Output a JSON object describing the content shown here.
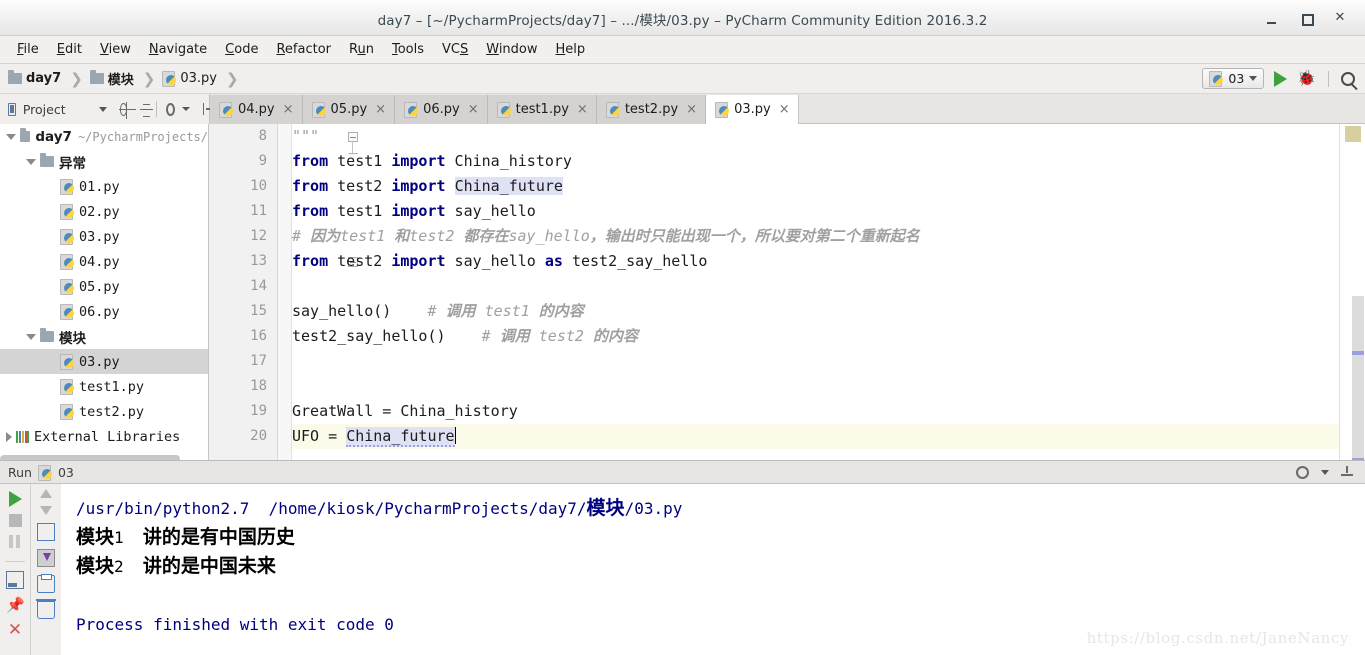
{
  "window": {
    "title": "day7 – [~/PycharmProjects/day7] – .../模块/03.py – PyCharm Community Edition 2016.3.2",
    "minimize_label": "–",
    "maximize_label": "□",
    "close_label": "✕"
  },
  "menubar": {
    "items": [
      {
        "label": "File"
      },
      {
        "label": "Edit"
      },
      {
        "label": "View"
      },
      {
        "label": "Navigate"
      },
      {
        "label": "Code"
      },
      {
        "label": "Refactor"
      },
      {
        "label": "Run"
      },
      {
        "label": "Tools"
      },
      {
        "label": "VCS"
      },
      {
        "label": "Window"
      },
      {
        "label": "Help"
      }
    ]
  },
  "breadcrumb": {
    "separator": "❯",
    "items": [
      {
        "label": "day7",
        "icon": "folder-icon"
      },
      {
        "label": "模块",
        "icon": "folder-icon"
      },
      {
        "label": "03.py",
        "icon": "python-file-icon"
      }
    ],
    "run_config": "03",
    "run_button": "run-icon",
    "debug_button": "debug-bug-icon",
    "search_button": "search-icon"
  },
  "project_panel": {
    "title": "Project",
    "toolbar": [
      "collapse-dropdown-icon",
      "locate-target-icon",
      "collapse-all-icon",
      "gear-icon",
      "hide-icon"
    ],
    "tree": [
      {
        "indent": 0,
        "twisty": "down",
        "icon": "folder-icon",
        "label": "day7",
        "suffix": "~/PycharmProjects/",
        "bold": true,
        "selected": false
      },
      {
        "indent": 1,
        "twisty": "down",
        "icon": "folder-icon",
        "label": "异常",
        "suffix": "",
        "bold": true,
        "selected": false
      },
      {
        "indent": 2,
        "twisty": "none",
        "icon": "python-file-icon",
        "label": "01.py",
        "suffix": "",
        "bold": false,
        "selected": false
      },
      {
        "indent": 2,
        "twisty": "none",
        "icon": "python-file-icon",
        "label": "02.py",
        "suffix": "",
        "bold": false,
        "selected": false
      },
      {
        "indent": 2,
        "twisty": "none",
        "icon": "python-file-icon",
        "label": "03.py",
        "suffix": "",
        "bold": false,
        "selected": false
      },
      {
        "indent": 2,
        "twisty": "none",
        "icon": "python-file-icon",
        "label": "04.py",
        "suffix": "",
        "bold": false,
        "selected": false
      },
      {
        "indent": 2,
        "twisty": "none",
        "icon": "python-file-icon",
        "label": "05.py",
        "suffix": "",
        "bold": false,
        "selected": false
      },
      {
        "indent": 2,
        "twisty": "none",
        "icon": "python-file-icon",
        "label": "06.py",
        "suffix": "",
        "bold": false,
        "selected": false
      },
      {
        "indent": 1,
        "twisty": "down",
        "icon": "folder-icon",
        "label": "模块",
        "suffix": "",
        "bold": true,
        "selected": false
      },
      {
        "indent": 2,
        "twisty": "none",
        "icon": "python-file-icon",
        "label": "03.py",
        "suffix": "",
        "bold": false,
        "selected": true
      },
      {
        "indent": 2,
        "twisty": "none",
        "icon": "python-file-icon",
        "label": "test1.py",
        "suffix": "",
        "bold": false,
        "selected": false
      },
      {
        "indent": 2,
        "twisty": "none",
        "icon": "python-file-icon",
        "label": "test2.py",
        "suffix": "",
        "bold": false,
        "selected": false
      },
      {
        "indent": 0,
        "twisty": "right",
        "icon": "library-icon",
        "label": "External Libraries",
        "suffix": "",
        "bold": false,
        "selected": false
      }
    ]
  },
  "editor_tabs": [
    {
      "label": "04.py",
      "active": false,
      "close": "×"
    },
    {
      "label": "05.py",
      "active": false,
      "close": "×"
    },
    {
      "label": "06.py",
      "active": false,
      "close": "×"
    },
    {
      "label": "test1.py",
      "active": false,
      "close": "×"
    },
    {
      "label": "test2.py",
      "active": false,
      "close": "×"
    },
    {
      "label": "03.py",
      "active": true,
      "close": "×"
    }
  ],
  "editor": {
    "first_line_number": 8,
    "current_line": 20,
    "lines": [
      {
        "n": 8,
        "segments": [
          {
            "t": "\"\"\"",
            "c": "cmt"
          }
        ]
      },
      {
        "n": 9,
        "segments": [
          {
            "t": "from",
            "c": "kw"
          },
          {
            "t": " test1 ",
            "c": ""
          },
          {
            "t": "import",
            "c": "kw"
          },
          {
            "t": " China_history",
            "c": ""
          }
        ]
      },
      {
        "n": 10,
        "segments": [
          {
            "t": "from",
            "c": "kw"
          },
          {
            "t": " test2 ",
            "c": ""
          },
          {
            "t": "import",
            "c": "kw"
          },
          {
            "t": " ",
            "c": ""
          },
          {
            "t": "China_future",
            "c": "hl"
          }
        ]
      },
      {
        "n": 11,
        "segments": [
          {
            "t": "from",
            "c": "kw"
          },
          {
            "t": " test1 ",
            "c": ""
          },
          {
            "t": "import",
            "c": "kw"
          },
          {
            "t": " say_hello",
            "c": ""
          }
        ]
      },
      {
        "n": 12,
        "segments": [
          {
            "t": "# 因为test1 和test2 都存在say_hello，输出时只能出现一个，所以要对第二个重新起名",
            "c": "cmt"
          }
        ]
      },
      {
        "n": 13,
        "segments": [
          {
            "t": "from",
            "c": "kw"
          },
          {
            "t": " test2 ",
            "c": ""
          },
          {
            "t": "import",
            "c": "kw"
          },
          {
            "t": " say_hello ",
            "c": ""
          },
          {
            "t": "as",
            "c": "kw"
          },
          {
            "t": " test2_say_hello",
            "c": ""
          }
        ]
      },
      {
        "n": 14,
        "segments": []
      },
      {
        "n": 15,
        "segments": [
          {
            "t": "say_hello()    ",
            "c": ""
          },
          {
            "t": "# 调用 test1 的内容",
            "c": "cmt"
          }
        ]
      },
      {
        "n": 16,
        "segments": [
          {
            "t": "test2_say_hello()    ",
            "c": ""
          },
          {
            "t": "# 调用 test2 的内容",
            "c": "cmt"
          }
        ]
      },
      {
        "n": 17,
        "segments": []
      },
      {
        "n": 18,
        "segments": []
      },
      {
        "n": 19,
        "segments": [
          {
            "t": "GreatWall = China_history",
            "c": ""
          }
        ]
      },
      {
        "n": 20,
        "segments": [
          {
            "t": "UFO = ",
            "c": ""
          },
          {
            "t": "China_future",
            "c": "err"
          }
        ]
      }
    ]
  },
  "run_panel": {
    "title": "Run",
    "config_name": "03",
    "icon": "python-icon",
    "left_toolbar": [
      "rerun-icon",
      "stop-icon",
      "pause-icon",
      "show-variables-icon",
      "pin-tab-icon",
      "close-icon"
    ],
    "right_toolbar": [
      "scroll-up-icon",
      "scroll-down-icon",
      "soft-wrap-icon",
      "scroll-to-end-icon",
      "print-icon",
      "clear-all-icon"
    ],
    "header_right": [
      "gear-icon",
      "hide-icon"
    ],
    "console_lines": [
      {
        "text": "/usr/bin/python2.7  /home/kiosk/PycharmProjects/day7/模块/03.py",
        "color": "blue"
      },
      {
        "text": "模块1  讲的是有中国历史",
        "color": "black"
      },
      {
        "text": "模块2  讲的是中国未来",
        "color": "black"
      },
      {
        "text": "",
        "color": "black"
      },
      {
        "text": "Process finished with exit code 0",
        "color": "blue"
      }
    ]
  },
  "watermark": "https://blog.csdn.net/JaneNancy",
  "colors": {
    "accent_blue": "#000080",
    "keyword": "#000080",
    "comment": "#a0a0a0",
    "highlight": "#dfe1f5",
    "current_line": "#fcfae8",
    "console_blue": "#00007f",
    "run_green": "#3ea33e"
  }
}
